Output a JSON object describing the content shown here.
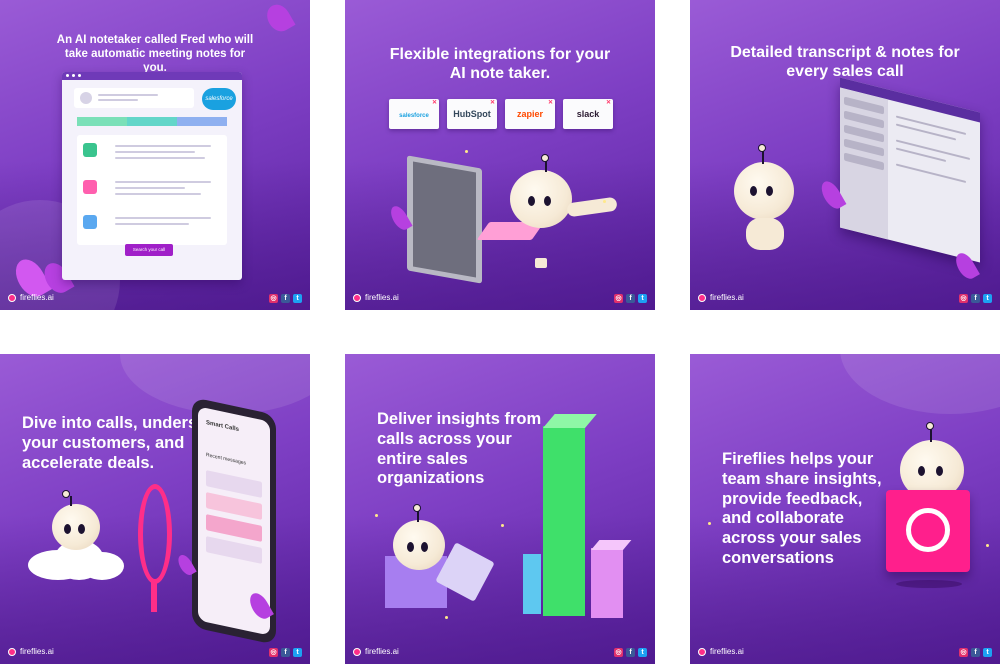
{
  "brand": "fireflies.ai",
  "colors": {
    "bg_purple": "#7e3fc4",
    "accent_pink": "#ff2e88",
    "text_white": "#ffffff"
  },
  "social_icons": [
    "instagram-icon",
    "facebook-icon",
    "twitter-icon"
  ],
  "tiles": [
    {
      "heading": "An AI notetaker called Fred who will take automatic meeting notes for you.",
      "badge": "salesforce",
      "button": "Search your call"
    },
    {
      "heading": "Flexible integrations for your AI note taker.",
      "integrations": [
        "salesforce",
        "HubSpot",
        "zapier",
        "slack"
      ]
    },
    {
      "heading": "Detailed transcript & notes for every sales call"
    },
    {
      "heading": "Dive into calls, understand your customers, and accelerate deals.",
      "phone_title": "Smart Calls",
      "phone_subtitle": "Recent messages"
    },
    {
      "heading": "Deliver insights from calls across your entire sales organizations"
    },
    {
      "heading": "Fireflies helps your team share insights, provide feedback, and collaborate across your sales conversations"
    }
  ]
}
